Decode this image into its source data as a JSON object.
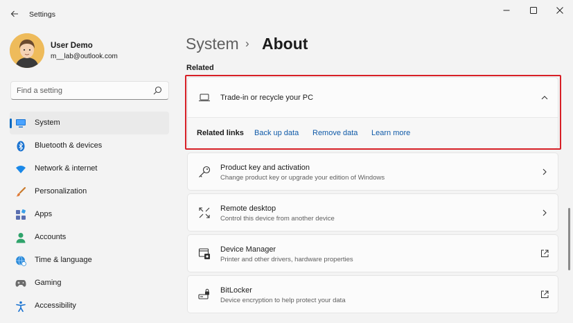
{
  "window": {
    "title": "Settings"
  },
  "user": {
    "name": "User Demo",
    "email": "m__lab@outlook.com"
  },
  "search": {
    "placeholder": "Find a setting"
  },
  "sidebar": {
    "items": [
      {
        "label": "System",
        "icon": "monitor-icon",
        "active": true
      },
      {
        "label": "Bluetooth & devices",
        "icon": "bluetooth-icon",
        "active": false
      },
      {
        "label": "Network & internet",
        "icon": "wifi-icon",
        "active": false
      },
      {
        "label": "Personalization",
        "icon": "brush-icon",
        "active": false
      },
      {
        "label": "Apps",
        "icon": "apps-icon",
        "active": false
      },
      {
        "label": "Accounts",
        "icon": "person-icon",
        "active": false
      },
      {
        "label": "Time & language",
        "icon": "globe-clock-icon",
        "active": false
      },
      {
        "label": "Gaming",
        "icon": "gamepad-icon",
        "active": false
      },
      {
        "label": "Accessibility",
        "icon": "accessibility-icon",
        "active": false
      }
    ]
  },
  "breadcrumb": {
    "parent": "System",
    "separator": "›",
    "current": "About"
  },
  "related": {
    "section_label": "Related",
    "expander": {
      "title": "Trade-in or recycle your PC",
      "expanded": true,
      "links_label": "Related links",
      "links": [
        "Back up data",
        "Remove data",
        "Learn more"
      ]
    },
    "cards": [
      {
        "title": "Product key and activation",
        "subtitle": "Change product key or upgrade your edition of Windows",
        "icon": "key-icon",
        "action": "chevron-right-icon"
      },
      {
        "title": "Remote desktop",
        "subtitle": "Control this device from another device",
        "icon": "remote-desktop-icon",
        "action": "chevron-right-icon"
      },
      {
        "title": "Device Manager",
        "subtitle": "Printer and other drivers, hardware properties",
        "icon": "device-manager-icon",
        "action": "open-external-icon"
      },
      {
        "title": "BitLocker",
        "subtitle": "Device encryption to help protect your data",
        "icon": "bitlocker-icon",
        "action": "open-external-icon"
      }
    ]
  },
  "colors": {
    "accent": "#0067c0",
    "highlight_border": "#d71f26",
    "link": "#0f5aa8"
  }
}
